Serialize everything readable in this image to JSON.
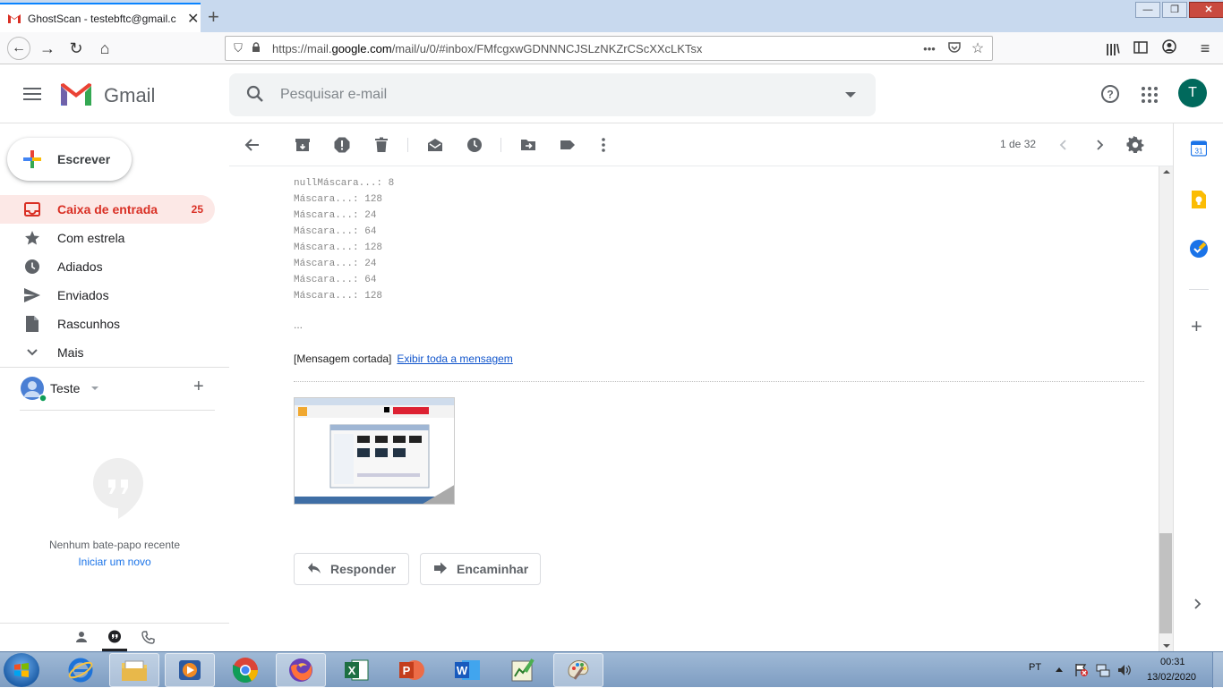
{
  "browser": {
    "tab_title": "GhostScan - testebftc@gmail.c",
    "url_prefix": "https://mail.",
    "url_domain": "google.com",
    "url_path": "/mail/u/0/#inbox/FMfcgxwGDNNNCJSLzNKZrCScXXcLKTsx"
  },
  "gmail": {
    "brand": "Gmail",
    "search_placeholder": "Pesquisar e-mail",
    "avatar_letter": "T",
    "compose_label": "Escrever",
    "nav": [
      {
        "label": "Caixa de entrada",
        "count": "25"
      },
      {
        "label": "Com estrela"
      },
      {
        "label": "Adiados"
      },
      {
        "label": "Enviados"
      },
      {
        "label": "Rascunhos"
      },
      {
        "label": "Mais"
      }
    ],
    "hangouts_user": "Teste",
    "chat_empty": "Nenhum bate-papo recente",
    "chat_start": "Iniciar um novo"
  },
  "toolbar": {
    "pager": "1 de 32"
  },
  "message": {
    "lines": [
      "nullMáscara...: 8",
      "Máscara...: 128",
      "Máscara...: 24",
      "Máscara...: 64",
      "Máscara...: 128",
      "Máscara...: 24",
      "Máscara...: 64",
      "Máscara...: 128"
    ],
    "ellipsis": "...",
    "clipped_label": "[Mensagem cortada]",
    "view_full": "Exibir toda a mensagem",
    "reply": "Responder",
    "forward": "Encaminhar"
  },
  "sidepanel": {
    "calendar_day": "31"
  },
  "taskbar": {
    "lang": "PT",
    "time": "00:31",
    "date": "13/02/2020"
  }
}
